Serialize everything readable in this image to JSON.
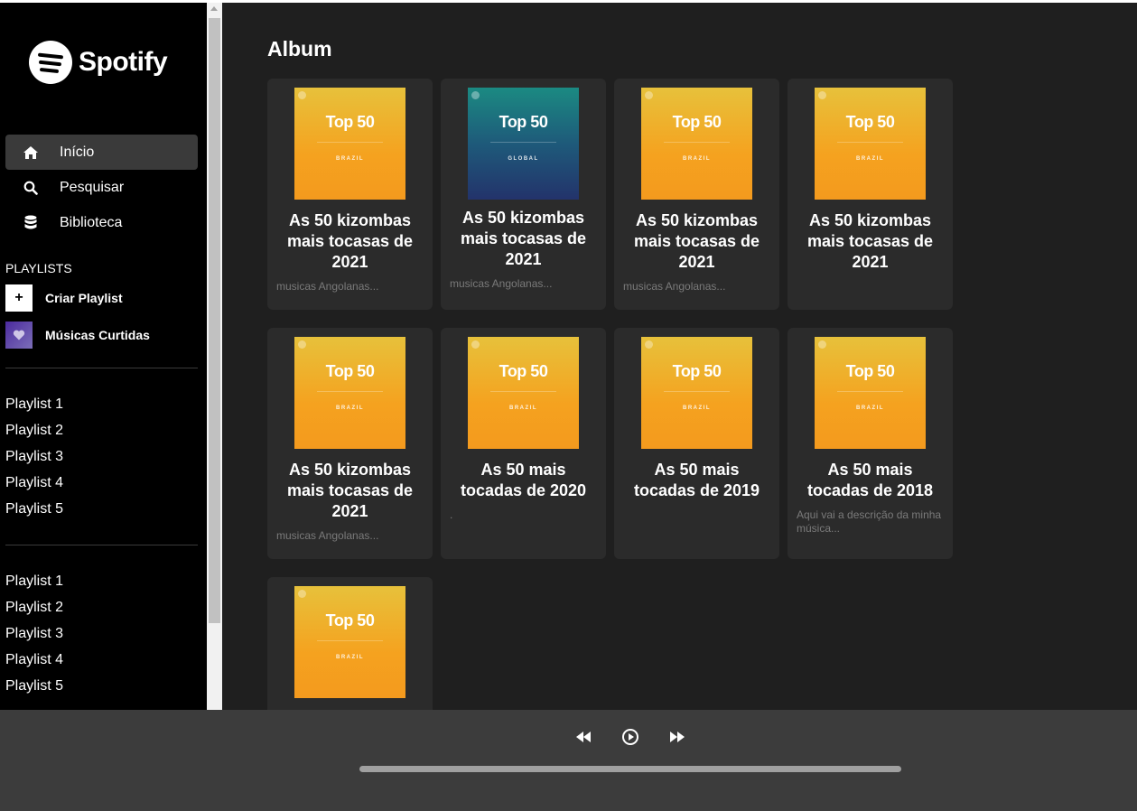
{
  "sidebar": {
    "logo_text": "Spotify",
    "nav": [
      {
        "label": "Início",
        "icon": "home-icon"
      },
      {
        "label": "Pesquisar",
        "icon": "search-icon"
      },
      {
        "label": "Biblioteca",
        "icon": "database-icon"
      }
    ],
    "playlists_header": "PLAYLISTS",
    "create_playlist": {
      "icon_glyph": "+",
      "label": "Criar Playlist"
    },
    "liked_songs": {
      "label": "Músicas Curtidas"
    },
    "playlist_group_1": [
      "Playlist 1",
      "Playlist 2",
      "Playlist 3",
      "Playlist 4",
      "Playlist 5"
    ],
    "playlist_group_2": [
      "Playlist 1",
      "Playlist 2",
      "Playlist 3",
      "Playlist 4",
      "Playlist 5"
    ]
  },
  "main": {
    "section_title": "Album",
    "cards": [
      {
        "cover_top": "Top 50",
        "cover_region": "BRAZIL",
        "title": "As 50 kizombas mais tocasas de 2021",
        "description": "musicas Angolanas..."
      },
      {
        "cover_top": "Top 50",
        "cover_region": "GLOBAL",
        "title": "As 50 kizombas mais tocasas de 2021",
        "description": "musicas Angolanas..."
      },
      {
        "cover_top": "Top 50",
        "cover_region": "BRAZIL",
        "title": "As 50 kizombas mais tocasas de 2021",
        "description": "musicas Angolanas..."
      },
      {
        "cover_top": "Top 50",
        "cover_region": "BRAZIL",
        "title": "As 50 kizombas mais tocasas de 2021",
        "description": ""
      },
      {
        "cover_top": "Top 50",
        "cover_region": "BRAZIL",
        "title": "As 50 kizombas mais tocasas de 2021",
        "description": "musicas Angolanas..."
      },
      {
        "cover_top": "Top 50",
        "cover_region": "BRAZIL",
        "title": "As 50 mais tocadas de 2020",
        "description": "."
      },
      {
        "cover_top": "Top 50",
        "cover_region": "BRAZIL",
        "title": "As 50 mais tocadas de 2019",
        "description": ""
      },
      {
        "cover_top": "Top 50",
        "cover_region": "BRAZIL",
        "title": "As 50 mais tocadas de 2018",
        "description": "Aqui vai a descrição da minha música..."
      },
      {
        "cover_top": "Top 50",
        "cover_region": "BRAZIL",
        "title": "",
        "description": ""
      }
    ]
  },
  "player": {
    "controls": [
      "rewind-icon",
      "play-icon",
      "fast-forward-icon"
    ],
    "progress": 0
  },
  "colors": {
    "sidebar_bg": "#000000",
    "main_bg": "#1f1f1f",
    "card_bg": "#2b2b2b",
    "player_bg": "#3c3c3c",
    "cover_brazil": "#f5a21f",
    "cover_global": "#23336b"
  }
}
